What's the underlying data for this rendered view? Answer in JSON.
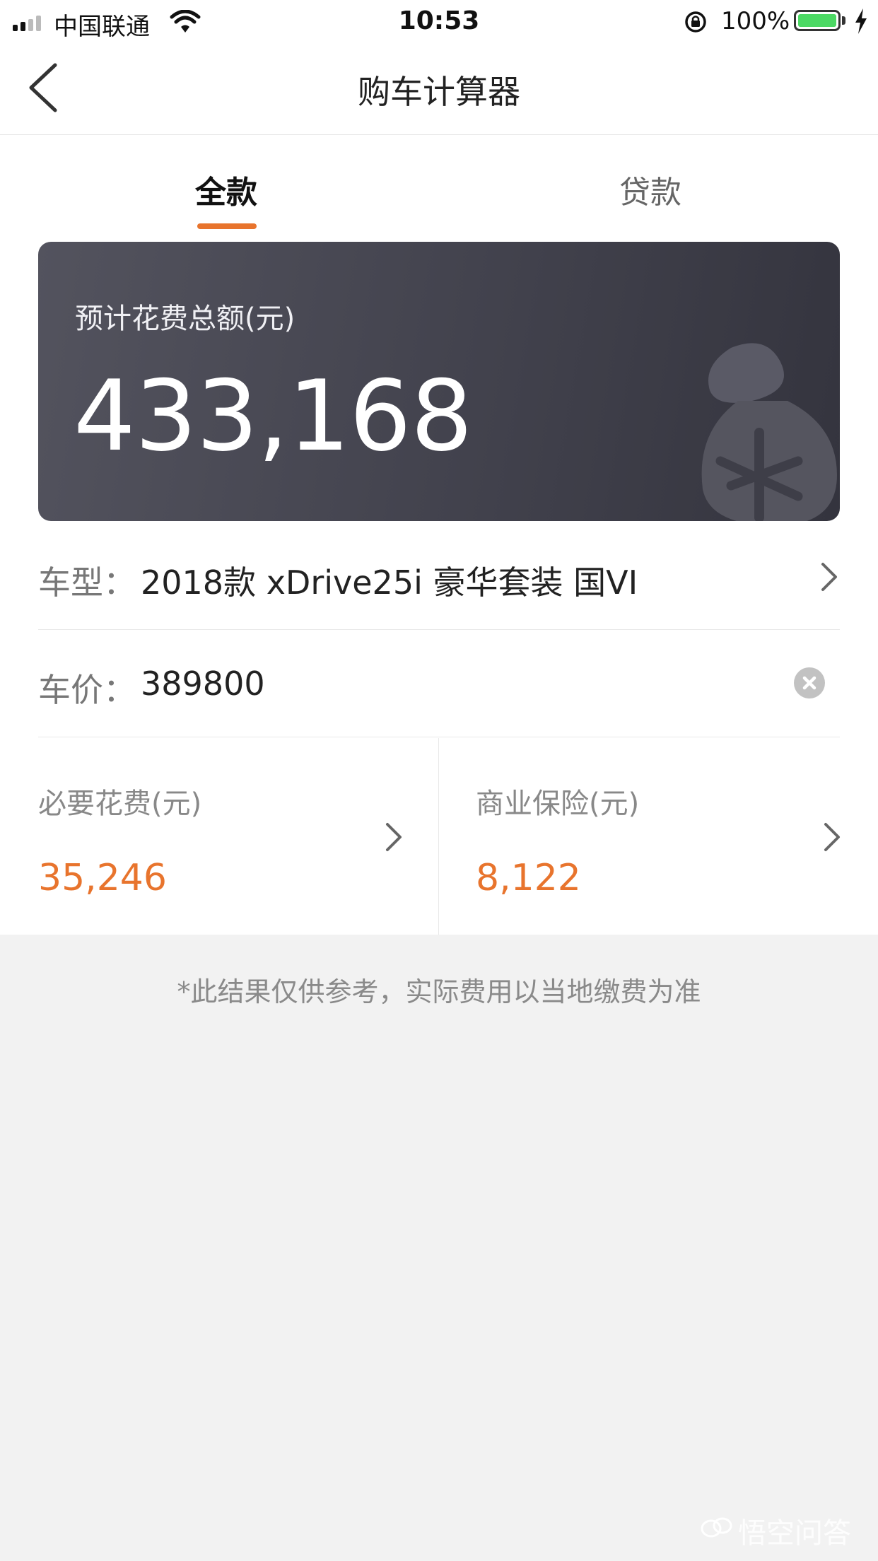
{
  "status_bar": {
    "carrier": "中国联通",
    "time": "10:53",
    "battery": "100%",
    "battery_color": "#4cd964"
  },
  "nav": {
    "title": "购车计算器",
    "back_icon": "chevron-left-icon"
  },
  "tabs": [
    {
      "label": "全款",
      "active": true
    },
    {
      "label": "贷款",
      "active": false
    }
  ],
  "summary": {
    "label": "预计花费总额(元)",
    "total": "433,168"
  },
  "form": {
    "model_label": "车型：",
    "model_value": "2018款 xDrive25i 豪华套装 国VI",
    "price_label": "车价：",
    "price_value": "389800"
  },
  "fees": [
    {
      "label": "必要花费(元)",
      "value": "35,246"
    },
    {
      "label": "商业保险(元)",
      "value": "8,122"
    }
  ],
  "note": "*此结果仅供参考，实际费用以当地缴费为准",
  "watermark": "悟空问答",
  "colors": {
    "accent": "#e8742d",
    "card_bg": "#4a4a55"
  }
}
